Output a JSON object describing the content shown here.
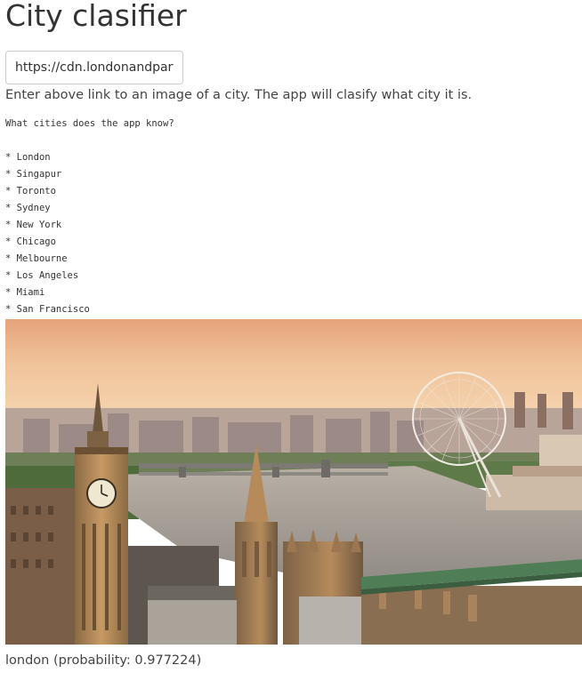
{
  "app": {
    "title": "City clasifier"
  },
  "form": {
    "url_value": "https://cdn.londonandpartners.com/visit/london-organisations/london-eye.jpg",
    "help_text": "Enter above link to an image of a city. The app will clasify what city it is."
  },
  "known_cities": {
    "question": "What cities does the app know?",
    "items": [
      "London",
      "Singapur",
      "Toronto",
      "Sydney",
      "New York",
      "Chicago",
      "Melbourne",
      "Los Angeles",
      "Miami",
      "San Francisco"
    ]
  },
  "result": {
    "text": "london (probability: 0.977224)"
  }
}
